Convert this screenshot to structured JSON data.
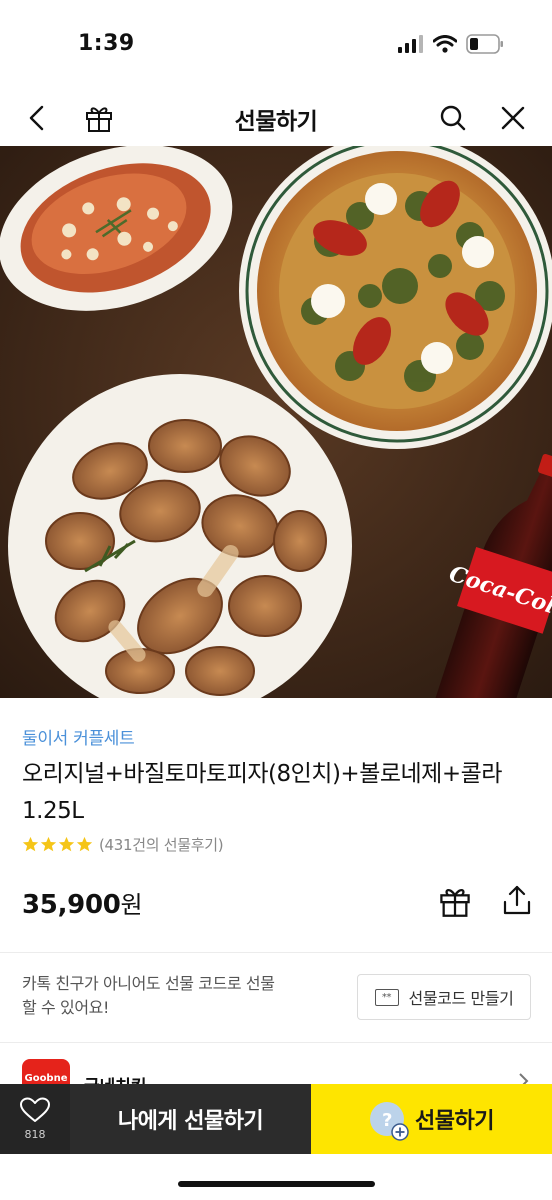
{
  "status": {
    "time": "1:39"
  },
  "nav": {
    "title": "선물하기"
  },
  "product": {
    "brand_line": "둘이서 커플세트",
    "title": "오리지널+바질토마토피자(8인치)+볼로네제+콜라1.25L",
    "rating_stars": 4,
    "review_count": "(431건의 선물후기)",
    "price_number": "35,900",
    "price_unit": "원"
  },
  "gift_code": {
    "description": "카톡 친구가 아니어도 선물 코드로 선물 할 수 있어요!",
    "button_icon_text": "**",
    "button_label": "선물코드 만들기"
  },
  "brand": {
    "logo_text": "Goobne",
    "name": "굽네치킨"
  },
  "bottom_bar": {
    "wish_count": "818",
    "self_gift_label": "나에게 선물하기",
    "gift_label": "선물하기"
  },
  "hero": {
    "coke_label": "Coca-Cola"
  },
  "colors": {
    "accent_yellow": "#fee500",
    "brand_blue": "#4a90d9",
    "star": "#f5c518",
    "dark_bar": "#2c2c2c",
    "goobne_red": "#e5231b"
  },
  "icons": [
    "signal-icon",
    "wifi-icon",
    "battery-icon",
    "back-icon",
    "gift-icon",
    "search-icon",
    "close-icon",
    "star-icon",
    "share-icon",
    "heart-icon",
    "chevron-right-icon"
  ]
}
